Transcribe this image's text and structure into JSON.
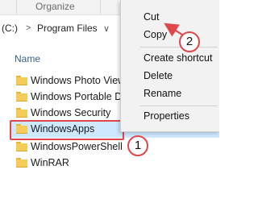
{
  "ribbon": {
    "organize_label": "Organize"
  },
  "address": {
    "drive_label": "(C:)",
    "separator": ">",
    "folder_label": "Program Files",
    "chevron": "∨"
  },
  "list_header": {
    "name_label": "Name"
  },
  "files": [
    {
      "name": "Windows Photo Viewer"
    },
    {
      "name": "Windows Portable Devices"
    },
    {
      "name": "Windows Security"
    },
    {
      "name": "WindowsApps"
    },
    {
      "name": "WindowsPowerShell"
    },
    {
      "name": "WinRAR"
    }
  ],
  "context_menu": {
    "items": [
      {
        "label": "Cut"
      },
      {
        "label": "Copy"
      },
      {
        "label": "Create shortcut"
      },
      {
        "label": "Delete"
      },
      {
        "label": "Rename"
      },
      {
        "label": "Properties"
      }
    ]
  },
  "callouts": {
    "one": "1",
    "two": "2"
  },
  "colors": {
    "accent_red": "#e0474c",
    "selection_blue": "#cde8ff",
    "folder_yellow": "#f5cc5a"
  },
  "icons": [
    "folder-icon",
    "chevron-down-icon"
  ]
}
